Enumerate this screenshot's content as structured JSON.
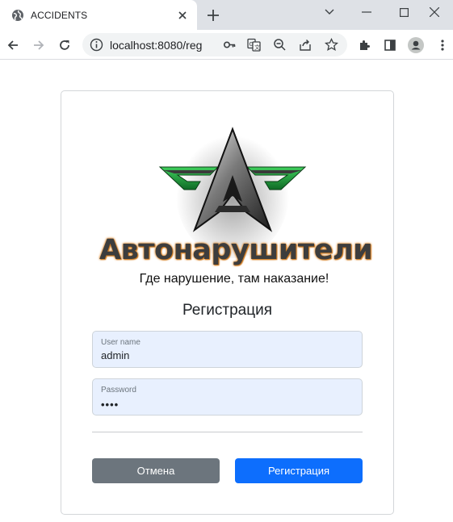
{
  "browser": {
    "tab_title": "ACCIDENTS",
    "url": "localhost:8080/reg"
  },
  "logo": {
    "brand_text": "Автонарушители",
    "slogan": "Где нарушение, там наказание!"
  },
  "form": {
    "title": "Регистрация",
    "username_label": "User name",
    "username_value": "admin",
    "password_label": "Password",
    "password_masked": "••••",
    "cancel_label": "Отмена",
    "submit_label": "Регистрация"
  },
  "colors": {
    "cancel_button": "#6c757d",
    "submit_button": "#0d6efd",
    "autofill_field": "#e8f0fe",
    "logo_green": "#1e8f3a"
  },
  "icons": {
    "tab": "globe-icon",
    "new_tab": "plus-icon",
    "toolbar": [
      "back-arrow-icon",
      "forward-arrow-icon",
      "reload-icon",
      "info-icon",
      "key-icon",
      "translate-icon",
      "zoom-out-icon",
      "share-icon",
      "star-icon",
      "extensions-icon",
      "side-panel-icon",
      "profile-icon",
      "more-menu-icon"
    ]
  }
}
